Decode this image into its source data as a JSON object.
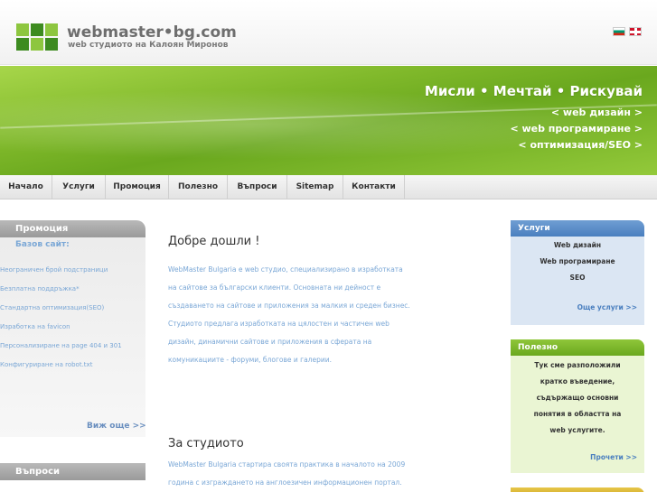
{
  "header": {
    "brand": "webmaster•bg.com",
    "subtitle": "web студиото на Калоян Миронов"
  },
  "banner": {
    "tagline": "Мисли • Мечтай • Рискувай",
    "links": [
      "< web дизайн >",
      "< web програмиране >",
      "< оптимизация/SEO >"
    ]
  },
  "nav": {
    "items": [
      "Начало",
      "Услуги",
      "Промоция",
      "Полезно",
      "Въпроси",
      "Sitemap",
      "Контакти"
    ]
  },
  "left": {
    "promo_title": "Промоция",
    "promo_sub": "Базов сайт:",
    "items": [
      "Неограничен брой подстраници",
      "Безплатна поддръжка*",
      "Стандартна оптимизация(SEO)",
      "Изработка на favicon",
      "Персонализиране на page 404 и 301",
      "Конфигуриране на robot.txt"
    ],
    "more": "Виж още >>",
    "questions_title": "Въпроси"
  },
  "main": {
    "welcome_title": "Добре дошли !",
    "welcome_lines": [
      "WebMaster Bulgaria е web студио, специализирано в изработката",
      "на сайтове за български клиенти. Основната ни дейност е",
      "създаването на сайтове и приложения за малкия и среден бизнес.",
      "Студиото предлага изработката на цялостен и частичен web",
      "дизайн, динамични сайтове и приложения в сферата на",
      "комуникациите - форуми, блогове и галерии."
    ],
    "about_title": "За студиото",
    "about_lines": [
      "WebMaster Bulgaria стартира своята практика в началото на 2009",
      "година с изграждането на англоезичен информационен портал."
    ]
  },
  "right": {
    "services_title": "Услуги",
    "services": [
      "Web дизайн",
      "Web програмиране",
      "SEO"
    ],
    "services_more": "Още услуги >>",
    "useful_title": "Полезно",
    "useful_lines": [
      "Тук сме разположили",
      "кратко въведение,",
      "съдържащо основни",
      "понятия в областта на",
      "web услугите."
    ],
    "useful_more": "Прочети >>"
  },
  "colors": {
    "accent_green": "#7fb82a",
    "link_blue": "#7aa7d6",
    "box_blue": "#4a7fbf"
  }
}
